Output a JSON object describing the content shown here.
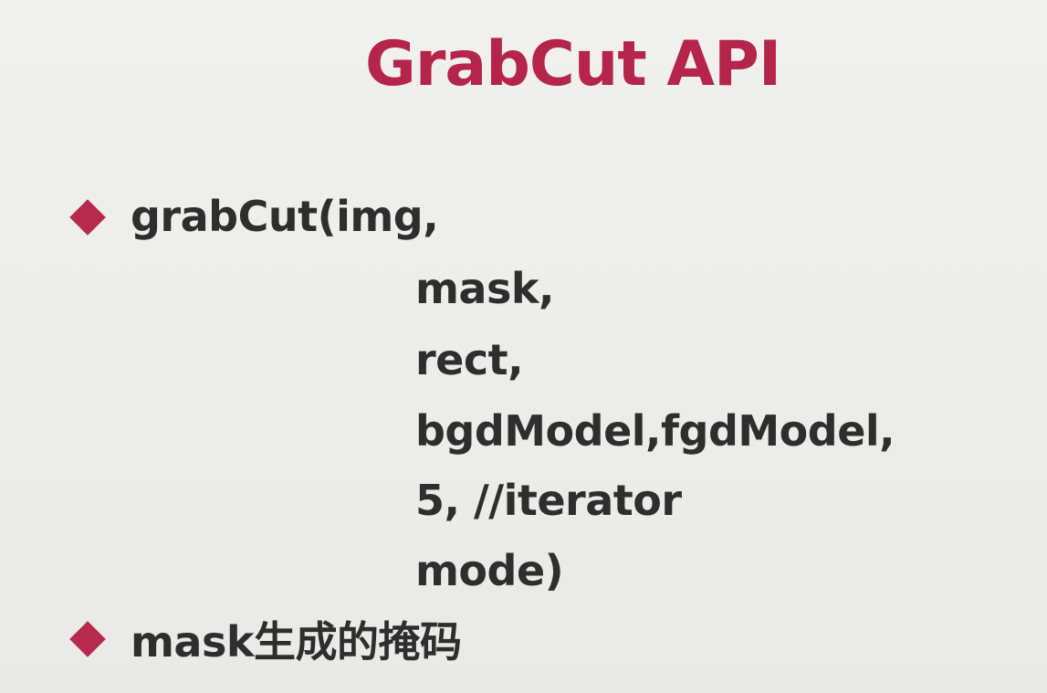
{
  "slide": {
    "title": "GrabCut API",
    "bullets": [
      {
        "label": "grabCut(img,",
        "params": [
          "mask,",
          "rect,",
          "bgdModel,fgdModel,",
          "5, //iterator",
          "mode)"
        ]
      },
      {
        "label": "mask生成的掩码"
      }
    ],
    "colors": {
      "title": "#b5244a",
      "bullet": "#b82a4d",
      "text": "#2e2e2e",
      "background": "#ededea"
    }
  }
}
